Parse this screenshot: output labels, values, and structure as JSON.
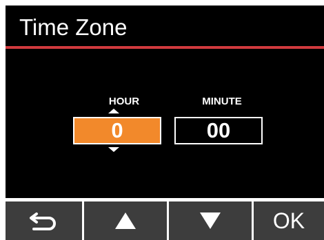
{
  "header": {
    "title": "Time Zone"
  },
  "fields": {
    "hour": {
      "label": "HOUR",
      "value": "0",
      "selected": true
    },
    "minute": {
      "label": "MINUTE",
      "value": "00",
      "selected": false
    }
  },
  "softkeys": {
    "back_icon": "return-arrow-icon",
    "up_icon": "triangle-up-icon",
    "down_icon": "triangle-down-icon",
    "ok_label": "OK"
  },
  "colors": {
    "header_background": "#000000",
    "divider": "#d13a3e",
    "selected_field": "#f2892b",
    "softkey_background": "#3d3d3d"
  }
}
